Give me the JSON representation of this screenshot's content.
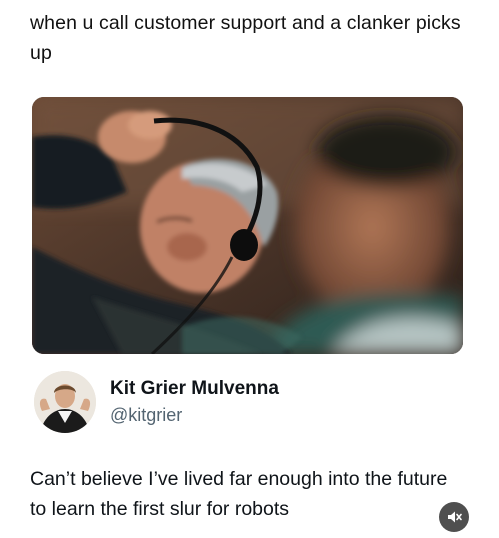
{
  "post": {
    "caption": "when u call customer support and a clanker picks up"
  },
  "embedded_tweet": {
    "author_name": "Kit Grier Mulvenna",
    "author_handle": "@kitgrier",
    "text": "Can’t believe I’ve lived far enough into the future to learn the first slur for robots"
  },
  "video_controls": {
    "mute_icon": "speaker-muted-icon"
  },
  "colors": {
    "text_primary": "#0f1419",
    "text_secondary": "#536471",
    "mute_button_bg": "#4f4f4f"
  }
}
